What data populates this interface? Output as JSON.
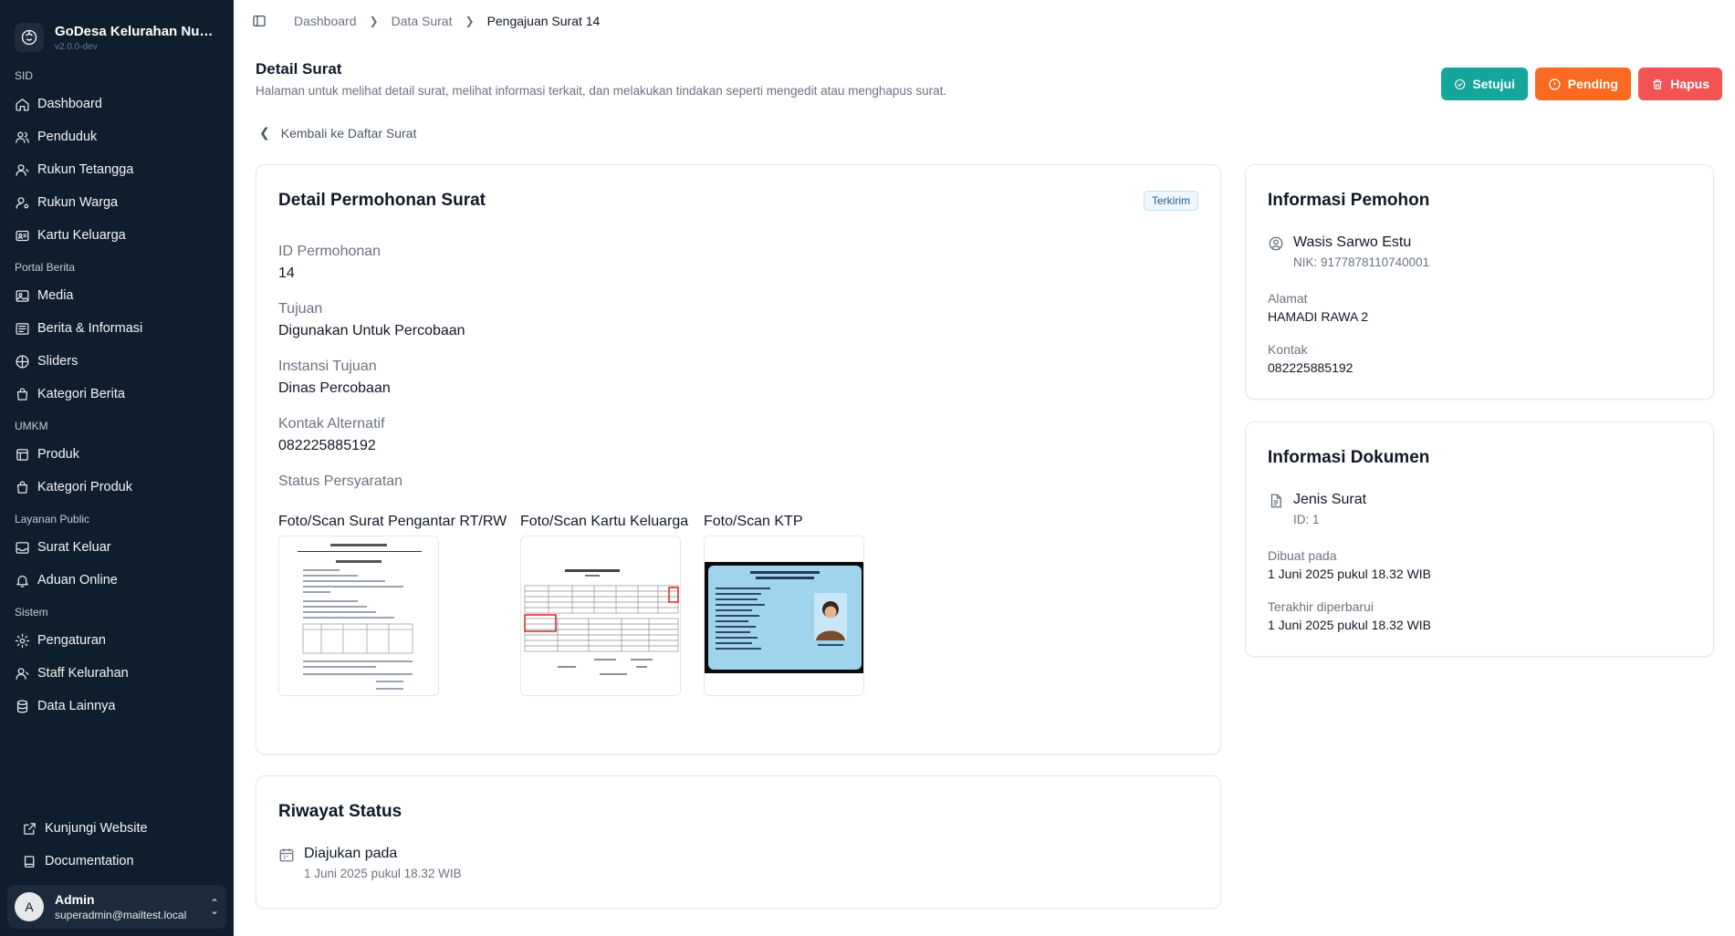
{
  "brand": {
    "name": "GoDesa Kelurahan Num...",
    "version": "v2.0.0-dev"
  },
  "sidebar": {
    "groups": [
      {
        "label": "SID",
        "items": [
          {
            "label": "Dashboard",
            "icon": "home-icon"
          },
          {
            "label": "Penduduk",
            "icon": "users-icon"
          },
          {
            "label": "Rukun Tetangga",
            "icon": "user-group-icon"
          },
          {
            "label": "Rukun Warga",
            "icon": "user-cog-icon"
          },
          {
            "label": "Kartu Keluarga",
            "icon": "id-card-icon"
          }
        ]
      },
      {
        "label": "Portal Berita",
        "items": [
          {
            "label": "Media",
            "icon": "image-icon"
          },
          {
            "label": "Berita & Informasi",
            "icon": "newspaper-icon"
          },
          {
            "label": "Sliders",
            "icon": "grid-icon"
          },
          {
            "label": "Kategori Berita",
            "icon": "shopping-bag-icon"
          }
        ]
      },
      {
        "label": "UMKM",
        "items": [
          {
            "label": "Produk",
            "icon": "store-icon"
          },
          {
            "label": "Kategori Produk",
            "icon": "shopping-bag-icon"
          }
        ]
      },
      {
        "label": "Layanan Public",
        "items": [
          {
            "label": "Surat Keluar",
            "icon": "inbox-icon"
          },
          {
            "label": "Aduan Online",
            "icon": "bell-icon"
          }
        ]
      },
      {
        "label": "Sistem",
        "items": [
          {
            "label": "Pengaturan",
            "icon": "gear-icon"
          },
          {
            "label": "Staff Kelurahan",
            "icon": "user-gear-icon"
          },
          {
            "label": "Data Lainnya",
            "icon": "database-icon"
          }
        ]
      }
    ],
    "bottom": [
      {
        "label": "Kunjungi Website",
        "icon": "external-link-icon"
      },
      {
        "label": "Documentation",
        "icon": "book-icon"
      }
    ],
    "user": {
      "initial": "A",
      "name": "Admin",
      "email": "superadmin@mailtest.local"
    }
  },
  "breadcrumb": [
    "Dashboard",
    "Data Surat",
    "Pengajuan Surat 14"
  ],
  "page": {
    "title": "Detail Surat",
    "description": "Halaman untuk melihat detail surat, melihat informasi terkait, dan melakukan tindakan seperti mengedit atau menghapus surat.",
    "back_label": "Kembali ke Daftar Surat"
  },
  "actions": {
    "approve": "Setujui",
    "pending": "Pending",
    "delete": "Hapus"
  },
  "detail": {
    "title": "Detail Permohonan Surat",
    "status_badge": "Terkirim",
    "fields": [
      {
        "label": "ID Permohonan",
        "value": "14"
      },
      {
        "label": "Tujuan",
        "value": "Digunakan Untuk Percobaan"
      },
      {
        "label": "Instansi Tujuan",
        "value": "Dinas Percobaan"
      },
      {
        "label": "Kontak Alternatif",
        "value": "082225885192"
      }
    ],
    "requirements_label": "Status Persyaratan",
    "documents": [
      {
        "label": "Foto/Scan Surat Pengantar RT/RW"
      },
      {
        "label": "Foto/Scan Kartu Keluarga"
      },
      {
        "label": "Foto/Scan KTP"
      }
    ]
  },
  "history": {
    "title": "Riwayat Status",
    "entry_label": "Diajukan pada",
    "entry_time": "1 Juni 2025 pukul 18.32 WIB"
  },
  "pemohon": {
    "title": "Informasi Pemohon",
    "name": "Wasis Sarwo Estu",
    "nik": "NIK: 9177878110740001",
    "address_label": "Alamat",
    "address": "HAMADI RAWA 2",
    "contact_label": "Kontak",
    "contact": "082225885192"
  },
  "dokumen": {
    "title": "Informasi Dokumen",
    "type": "Jenis Surat",
    "id": "ID: 1",
    "created_label": "Dibuat pada",
    "created": "1 Juni 2025 pukul 18.32 WIB",
    "updated_label": "Terakhir diperbarui",
    "updated": "1 Juni 2025 pukul 18.32 WIB"
  },
  "colors": {
    "sidebar_bg": "#0f1e2d",
    "approve": "#14a59b",
    "pending": "#fb6a21",
    "delete": "#f25454"
  }
}
